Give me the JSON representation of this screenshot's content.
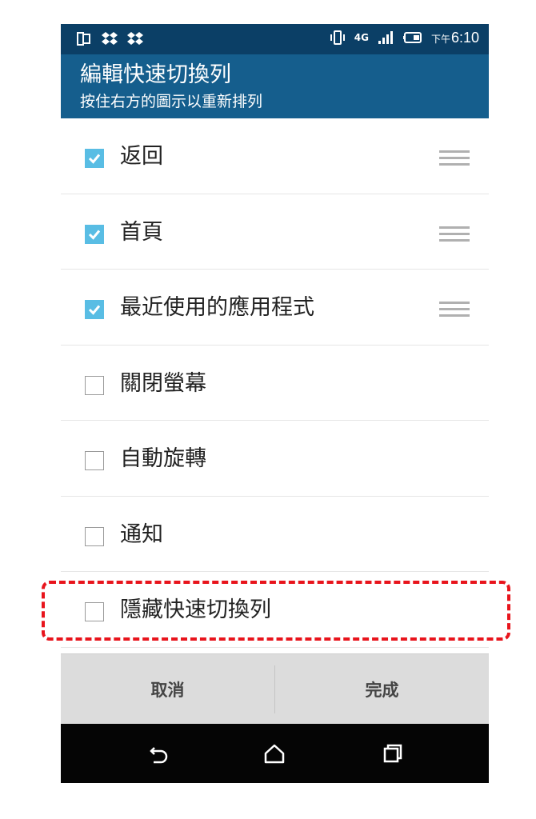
{
  "status_bar": {
    "left_icons": [
      "screen-icon",
      "dropbox-icon",
      "dropbox-icon"
    ],
    "right_icons": [
      "vibrate-icon",
      "4g-icon",
      "signal-icon",
      "battery-icon"
    ],
    "network": "4G",
    "ampm": "下午",
    "time": "6:10"
  },
  "header": {
    "title": "編輯快速切換列",
    "subtitle": "按住右方的圖示以重新排列"
  },
  "items": [
    {
      "label": "返回",
      "checked": true,
      "draggable": true
    },
    {
      "label": "首頁",
      "checked": true,
      "draggable": true
    },
    {
      "label": "最近使用的應用程式",
      "checked": true,
      "draggable": true
    },
    {
      "label": "關閉螢幕",
      "checked": false,
      "draggable": false
    },
    {
      "label": "自動旋轉",
      "checked": false,
      "draggable": false
    },
    {
      "label": "通知",
      "checked": false,
      "draggable": false
    },
    {
      "label": "隱藏快速切換列",
      "checked": false,
      "draggable": false
    }
  ],
  "buttons": {
    "cancel": "取消",
    "done": "完成"
  },
  "nav": {
    "icons": [
      "back-icon",
      "home-icon",
      "recent-apps-icon"
    ]
  },
  "colors": {
    "status_bar": "#0b3f66",
    "title_bar": "#155e8d",
    "checkbox_checked": "#59bde4",
    "highlight": "#e8141c"
  }
}
